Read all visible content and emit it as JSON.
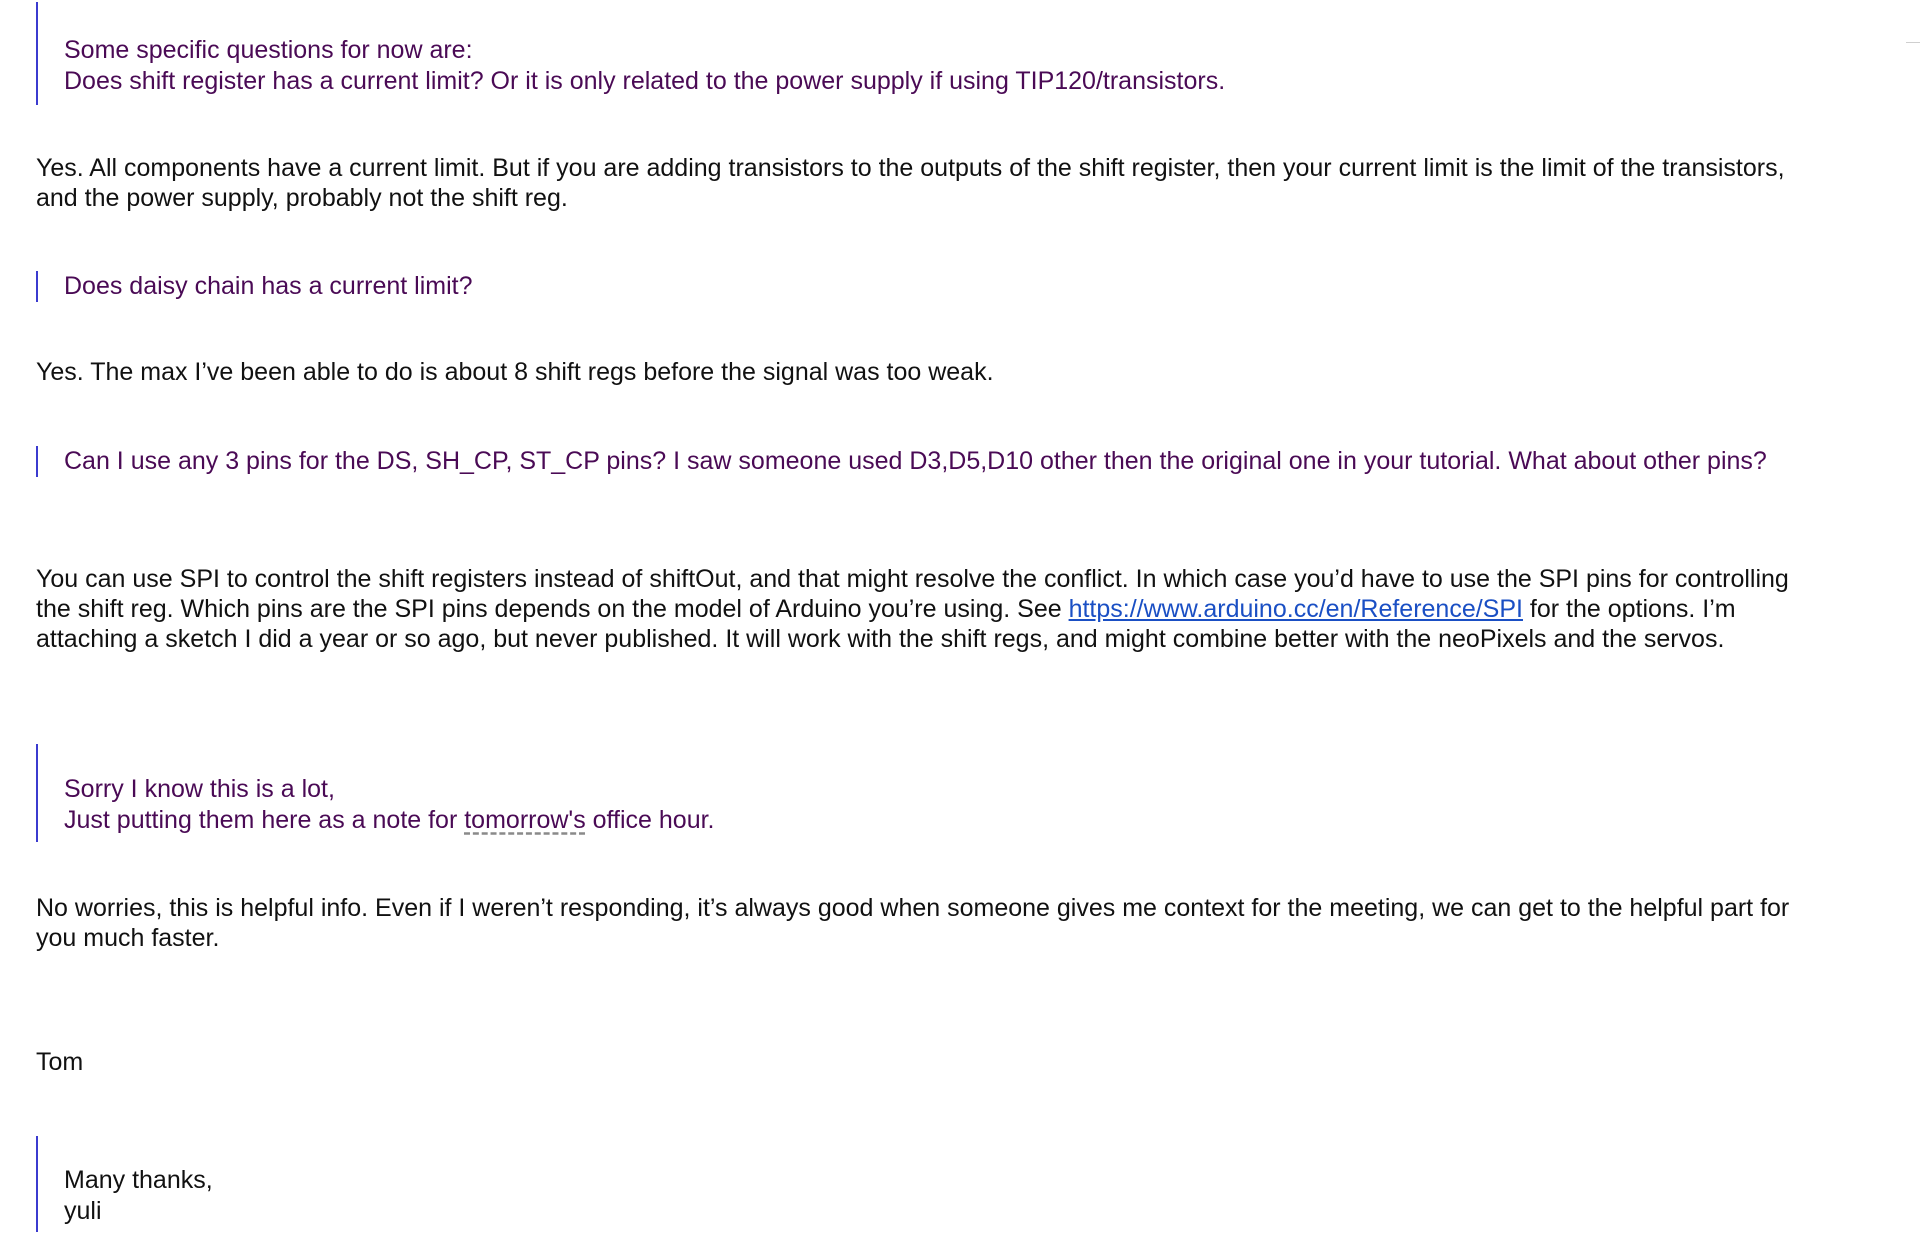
{
  "thread": {
    "q1_line1": "Some specific questions for now are:",
    "q1_line2": "Does shift register has a current limit? Or it is only related to the power supply if using TIP120/transistors.",
    "a1_line1": "Yes. All components have a current limit. But if you are adding transistors to the outputs of the shift register, then your current limit is the limit of the transistors,",
    "a1_line2": "and the power supply, probably not the shift reg.",
    "q2": "Does daisy chain has a current limit?",
    "a2": "Yes. The max I’ve been able to do is about 8 shift regs before the signal was too weak.",
    "q3": "Can I use any 3 pins for the DS, SH_CP, ST_CP pins? I saw someone used D3,D5,D10 other then the original one in your tutorial. What about other pins?",
    "a3_line1": "You can use SPI to control the shift registers instead of shiftOut, and that might resolve the conflict. In which case you’d have to use the SPI pins for controlling",
    "a3_line2_before": "the shift reg. Which pins are the SPI pins depends on the model of Arduino you’re using. See ",
    "a3_link": "https://www.arduino.cc/en/Reference/SPI",
    "a3_line2_after": " for the options.  I’m",
    "a3_line3": "attaching a sketch I did a year or so ago, but never published. It will work with the shift regs, and might combine better with the neoPixels and the servos.",
    "q4_line1": "Sorry I know this is a lot,",
    "q4_line2_before": "Just putting them here as a note for ",
    "q4_line2_word": "tomorrow's",
    "q4_line2_after": " office hour.",
    "a4_line1": "No worries, this is helpful info. Even if I weren’t responding, it’s always good when someone gives me context for the meeting, we can get to the helpful part for",
    "a4_line2": "you much faster.",
    "signature": "Tom",
    "closing_line1": "Many thanks,",
    "closing_line2": "yuli"
  },
  "colors": {
    "quoted_text": "#4a0a55",
    "quote_bar": "#3b3bcf",
    "reply_text": "#111111",
    "link": "#1a4fc4"
  }
}
